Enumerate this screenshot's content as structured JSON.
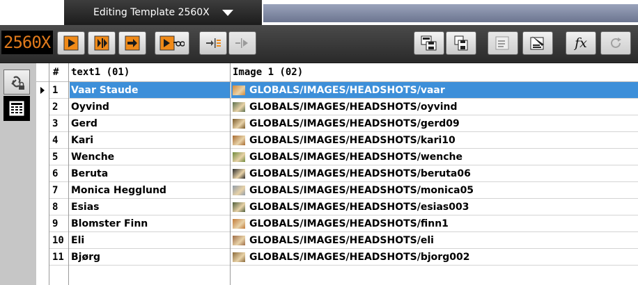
{
  "title_bar": {
    "tab_title": "Editing Template 2560X",
    "dropdown_icon": "caret-down-icon"
  },
  "toolbar": {
    "counter": "2560X",
    "buttons": [
      {
        "name": "play-icon",
        "label": ""
      },
      {
        "name": "play-pause-icon",
        "label": ""
      },
      {
        "name": "continue-arrow-icon",
        "label": ""
      },
      {
        "name": "play-connect-icon",
        "label": ""
      },
      {
        "name": "take-in-icon",
        "label": ""
      },
      {
        "name": "take-out-icon",
        "label": ""
      },
      {
        "name": "save-template-icon",
        "label": ""
      },
      {
        "name": "save-icon",
        "label": ""
      },
      {
        "name": "edit-script-icon",
        "label": ""
      },
      {
        "name": "script-tools-icon",
        "label": ""
      },
      {
        "name": "function-icon",
        "label": "fx"
      },
      {
        "name": "refresh-icon",
        "label": ""
      }
    ]
  },
  "left_rail": {
    "items": [
      {
        "name": "link-lock-icon"
      },
      {
        "name": "table-icon",
        "active": true
      }
    ]
  },
  "table": {
    "columns": [
      "#",
      "text1 (01)",
      "Image 1 (02)"
    ],
    "rows": [
      {
        "num": "1",
        "text": "Vaar Staude",
        "image": "GLOBALS/IMAGES/HEADSHOTS/vaar",
        "thumb": "#d48a3a"
      },
      {
        "num": "2",
        "text": "Oyvind",
        "image": "GLOBALS/IMAGES/HEADSHOTS/oyvind",
        "thumb": "#5a6f4c"
      },
      {
        "num": "3",
        "text": "Gerd",
        "image": "GLOBALS/IMAGES/HEADSHOTS/gerd09",
        "thumb": "#7a5a2a"
      },
      {
        "num": "4",
        "text": "Kari",
        "image": "GLOBALS/IMAGES/HEADSHOTS/kari10",
        "thumb": "#a6692f"
      },
      {
        "num": "5",
        "text": "Wenche",
        "image": "GLOBALS/IMAGES/HEADSHOTS/wenche",
        "thumb": "#6f8a3c"
      },
      {
        "num": "6",
        "text": "Beruta",
        "image": "GLOBALS/IMAGES/HEADSHOTS/beruta06",
        "thumb": "#2b2b2b"
      },
      {
        "num": "7",
        "text": "Monica Hegglund",
        "image": "GLOBALS/IMAGES/HEADSHOTS/monica05",
        "thumb": "#8e9aa8"
      },
      {
        "num": "8",
        "text": "Esias",
        "image": "GLOBALS/IMAGES/HEADSHOTS/esias003",
        "thumb": "#4e5d3a"
      },
      {
        "num": "9",
        "text": "Blomster Finn",
        "image": "GLOBALS/IMAGES/HEADSHOTS/finn1",
        "thumb": "#c27b3a"
      },
      {
        "num": "10",
        "text": "Eli",
        "image": "GLOBALS/IMAGES/HEADSHOTS/eli",
        "thumb": "#9d6b45"
      },
      {
        "num": "11",
        "text": "Bjørg",
        "image": "GLOBALS/IMAGES/HEADSHOTS/bjorg002",
        "thumb": "#8a6a3a"
      }
    ],
    "selected_row": 0
  },
  "colors": {
    "selection": "#3d8fd9",
    "counter_text": "#e07a1c",
    "accent_orange": "#f08a18"
  }
}
